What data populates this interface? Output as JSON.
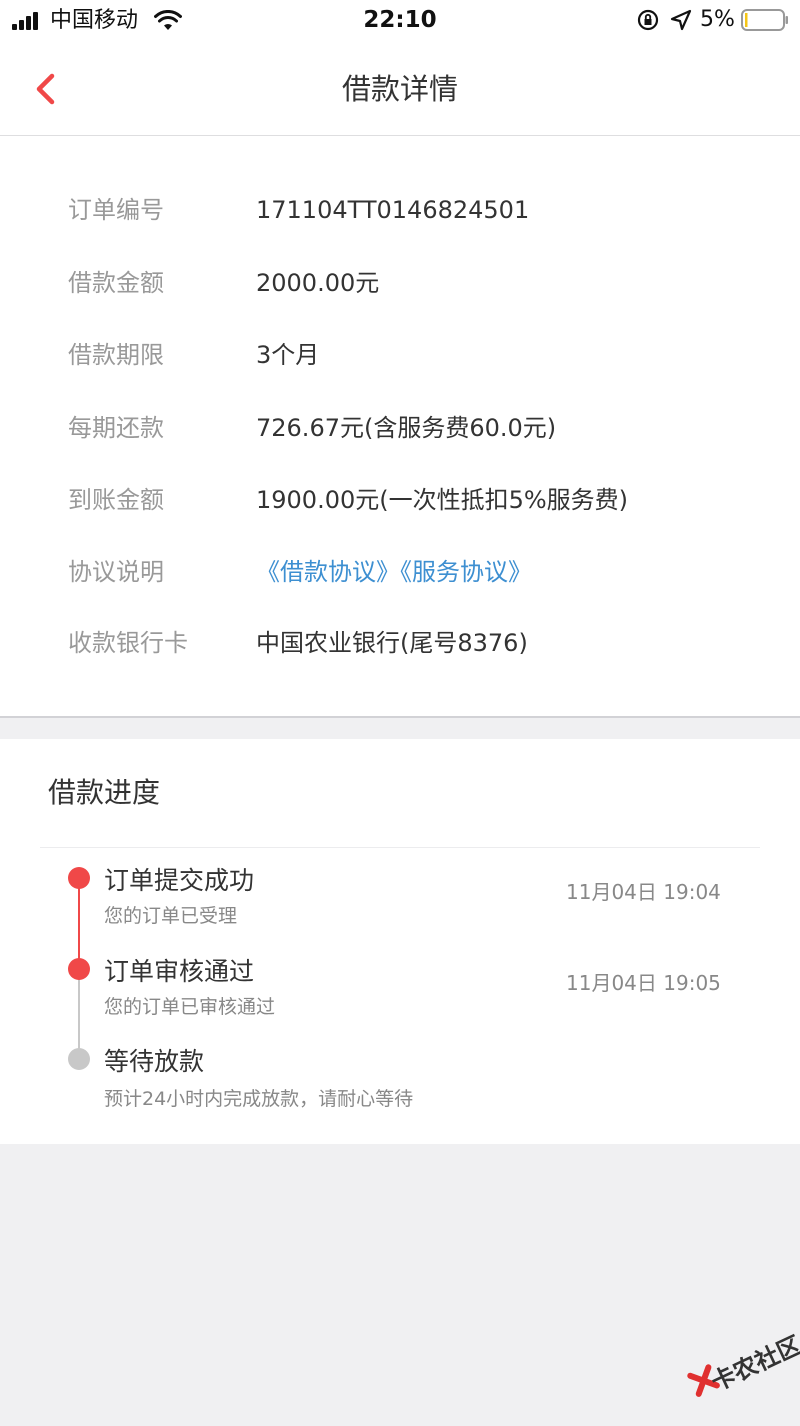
{
  "status_bar": {
    "carrier": "中国移动",
    "time": "22:10",
    "battery": "5%"
  },
  "nav": {
    "title": "借款详情",
    "back_icon": "chevron-left-icon"
  },
  "details": [
    {
      "label": "订单编号",
      "value": "171104TT0146824501"
    },
    {
      "label": "借款金额",
      "value": "2000.00元"
    },
    {
      "label": "借款期限",
      "value": "3个月"
    },
    {
      "label": "每期还款",
      "value": "726.67元(含服务费60.0元)"
    },
    {
      "label": "到账金额",
      "value": "1900.00元(一次性抵扣5%服务费)"
    },
    {
      "label": "协议说明",
      "links": [
        "《借款协议》",
        "《服务协议》"
      ]
    },
    {
      "label": "收款银行卡",
      "value": "中国农业银行(尾号8376)"
    }
  ],
  "progress": {
    "title": "借款进度",
    "steps": [
      {
        "title": "订单提交成功",
        "subtitle": "您的订单已受理",
        "time": "11月04日 19:04",
        "status": "done"
      },
      {
        "title": "订单审核通过",
        "subtitle": "您的订单已审核通过",
        "time": "11月04日 19:05",
        "status": "done"
      },
      {
        "title": "等待放款",
        "subtitle": "预计24小时内完成放款，请耐心等待",
        "time": "",
        "status": "pending"
      }
    ]
  },
  "colors": {
    "accent": "#f04848",
    "link": "#3d8fd1",
    "pending": "#c8c8c8"
  },
  "watermark": "卡农社区"
}
